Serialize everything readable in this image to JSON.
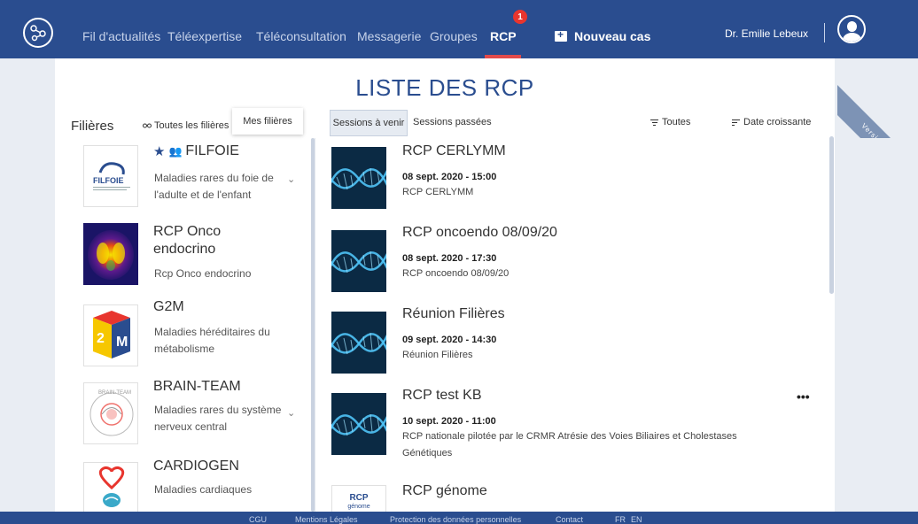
{
  "nav": {
    "items": [
      {
        "label": "Fil d'actualités"
      },
      {
        "label": "Téléexpertise"
      },
      {
        "label": "Téléconsultation"
      },
      {
        "label": "Messagerie"
      },
      {
        "label": "Groupes"
      },
      {
        "label": "RCP"
      }
    ],
    "rcp_badge": "1",
    "new_case": "Nouveau cas",
    "user_name": "Dr. Emilie Lebeux"
  },
  "beta_label": "Version bêta",
  "page_title": "LISTE DES RCP",
  "filieres": {
    "label": "Filières",
    "btn_toutes": "Toutes les filières",
    "btn_mes": "Mes filières",
    "items": [
      {
        "title": "FILFOIE",
        "subtitle": "Maladies rares du foie de l'adulte et de l'enfant",
        "logo_text": "FILFOIE"
      },
      {
        "title": "RCP Onco endocrino",
        "subtitle": "Rcp Onco endocrino"
      },
      {
        "title": "G2M",
        "subtitle": "Maladies héréditaires du métabolisme"
      },
      {
        "title": "BRAIN-TEAM",
        "subtitle": "Maladies rares du système nerveux central",
        "logo_text": "BRAIN-TEAM"
      },
      {
        "title": "CARDIOGEN",
        "subtitle": "Maladies cardiaques"
      }
    ]
  },
  "sessions": {
    "tab_upcoming": "Sessions à venir",
    "tab_past": "Sessions passées",
    "filter_label": "Toutes",
    "sort_label": "Date croissante",
    "items": [
      {
        "title": "RCP CERLYMM",
        "date": "08 sept. 2020 - 15:00",
        "desc": "RCP CERLYMM"
      },
      {
        "title": "RCP oncoendo 08/09/20",
        "date": "08 sept. 2020 - 17:30",
        "desc": "RCP oncoendo 08/09/20"
      },
      {
        "title": "Réunion Filières",
        "date": "09 sept. 2020 - 14:30",
        "desc": "Réunion Filières"
      },
      {
        "title": "RCP test KB",
        "date": "10 sept. 2020 - 11:00",
        "desc": "RCP nationale pilotée par le CRMR Atrésie des Voies Biliaires et Cholestases Génétiques",
        "more": "•••"
      },
      {
        "title": "RCP génome",
        "logo_text_1": "RCP",
        "logo_text_2": "génome"
      }
    ]
  },
  "footer": {
    "links": [
      "CGU",
      "Mentions Légales",
      "Protection des données personnelles",
      "Contact",
      "FR",
      "EN"
    ]
  },
  "colors": {
    "nav_bg": "#2a4d8f",
    "title_blue": "#2a4d8f",
    "badge_red": "#e8352e"
  }
}
